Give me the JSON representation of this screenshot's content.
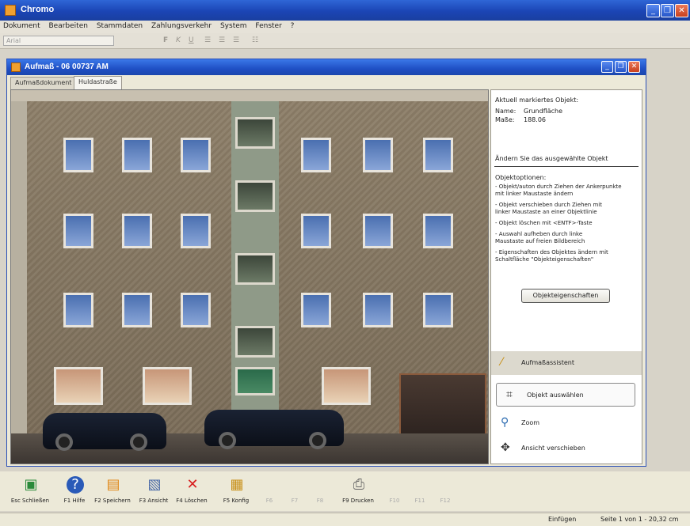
{
  "app": {
    "title": "Chromo"
  },
  "menu": [
    "Dokument",
    "Bearbeiten",
    "Stammdaten",
    "Zahlungsverkehr",
    "System",
    "Fenster",
    "?"
  ],
  "toolbar": {
    "combo_value": "Arial",
    "format_items": [
      "F",
      "K",
      "U"
    ]
  },
  "inner_window": {
    "title": "Aufmaß - 06 00737 AM",
    "tabs": [
      {
        "label": "Aufmaßdokument",
        "active": false
      },
      {
        "label": "Huldastraße",
        "active": true
      }
    ]
  },
  "panel": {
    "current_object_title": "Aktuell markiertes Objekt:",
    "name_label": "Name:",
    "name_value": "Grundfläche",
    "mass_label": "Maße:",
    "mass_value": "188.06",
    "change_hint": "Ändern Sie das ausgewählte Objekt",
    "options_title": "Objektoptionen:",
    "options": [
      "- Objekt/auton durch Ziehen der Ankerpunkte",
      "  mit linker Maustaste ändern",
      "- Objekt verschieben durch Ziehen mit",
      "  linker Maustaste an einer Objektlinie",
      "- Objekt löschen mit <ENTF>-Taste",
      "- Auswahl aufheben durch linke",
      "  Maustaste auf freien Bildbereich",
      "- Eigenschaften des Objektes ändern mit",
      "  Schaltfläche \"Objekteigenschaften\""
    ],
    "properties_button": "Objekteigenschaften",
    "tasks": [
      {
        "icon": "wand-icon",
        "label": "Aufmaßassistent"
      },
      {
        "icon": "select-object-icon",
        "label": "Objekt auswählen"
      },
      {
        "icon": "magnifier-icon",
        "label": "Zoom"
      },
      {
        "icon": "move-arrows-icon",
        "label": "Ansicht verschieben"
      }
    ]
  },
  "fkeys": [
    {
      "label": "Esc Schließen",
      "icon": "close-doc-icon",
      "enabled": true
    },
    {
      "label": "F1 Hilfe",
      "icon": "help-icon",
      "enabled": true
    },
    {
      "label": "F2 Speichern",
      "icon": "save-icon",
      "enabled": true
    },
    {
      "label": "F3 Ansicht",
      "icon": "view-icon",
      "enabled": true
    },
    {
      "label": "F4 Löschen",
      "icon": "delete-icon",
      "enabled": true
    },
    {
      "label": "F5 Konfig",
      "icon": "config-icon",
      "enabled": true
    },
    {
      "label": "F6",
      "icon": "",
      "enabled": false
    },
    {
      "label": "F7",
      "icon": "",
      "enabled": false
    },
    {
      "label": "F8",
      "icon": "",
      "enabled": false
    },
    {
      "label": "F9 Drucken",
      "icon": "printer-icon",
      "enabled": true
    },
    {
      "label": "F10",
      "icon": "",
      "enabled": false
    },
    {
      "label": "F11",
      "icon": "",
      "enabled": false
    },
    {
      "label": "F12",
      "icon": "",
      "enabled": false
    }
  ],
  "status": {
    "mode": "Einfügen",
    "page": "Seite 1 von 1 - 20,32 cm"
  },
  "colors": {
    "titlebar": "#1f4fc4",
    "panel_bg": "#ffffff",
    "delete_icon": "#d82020"
  }
}
